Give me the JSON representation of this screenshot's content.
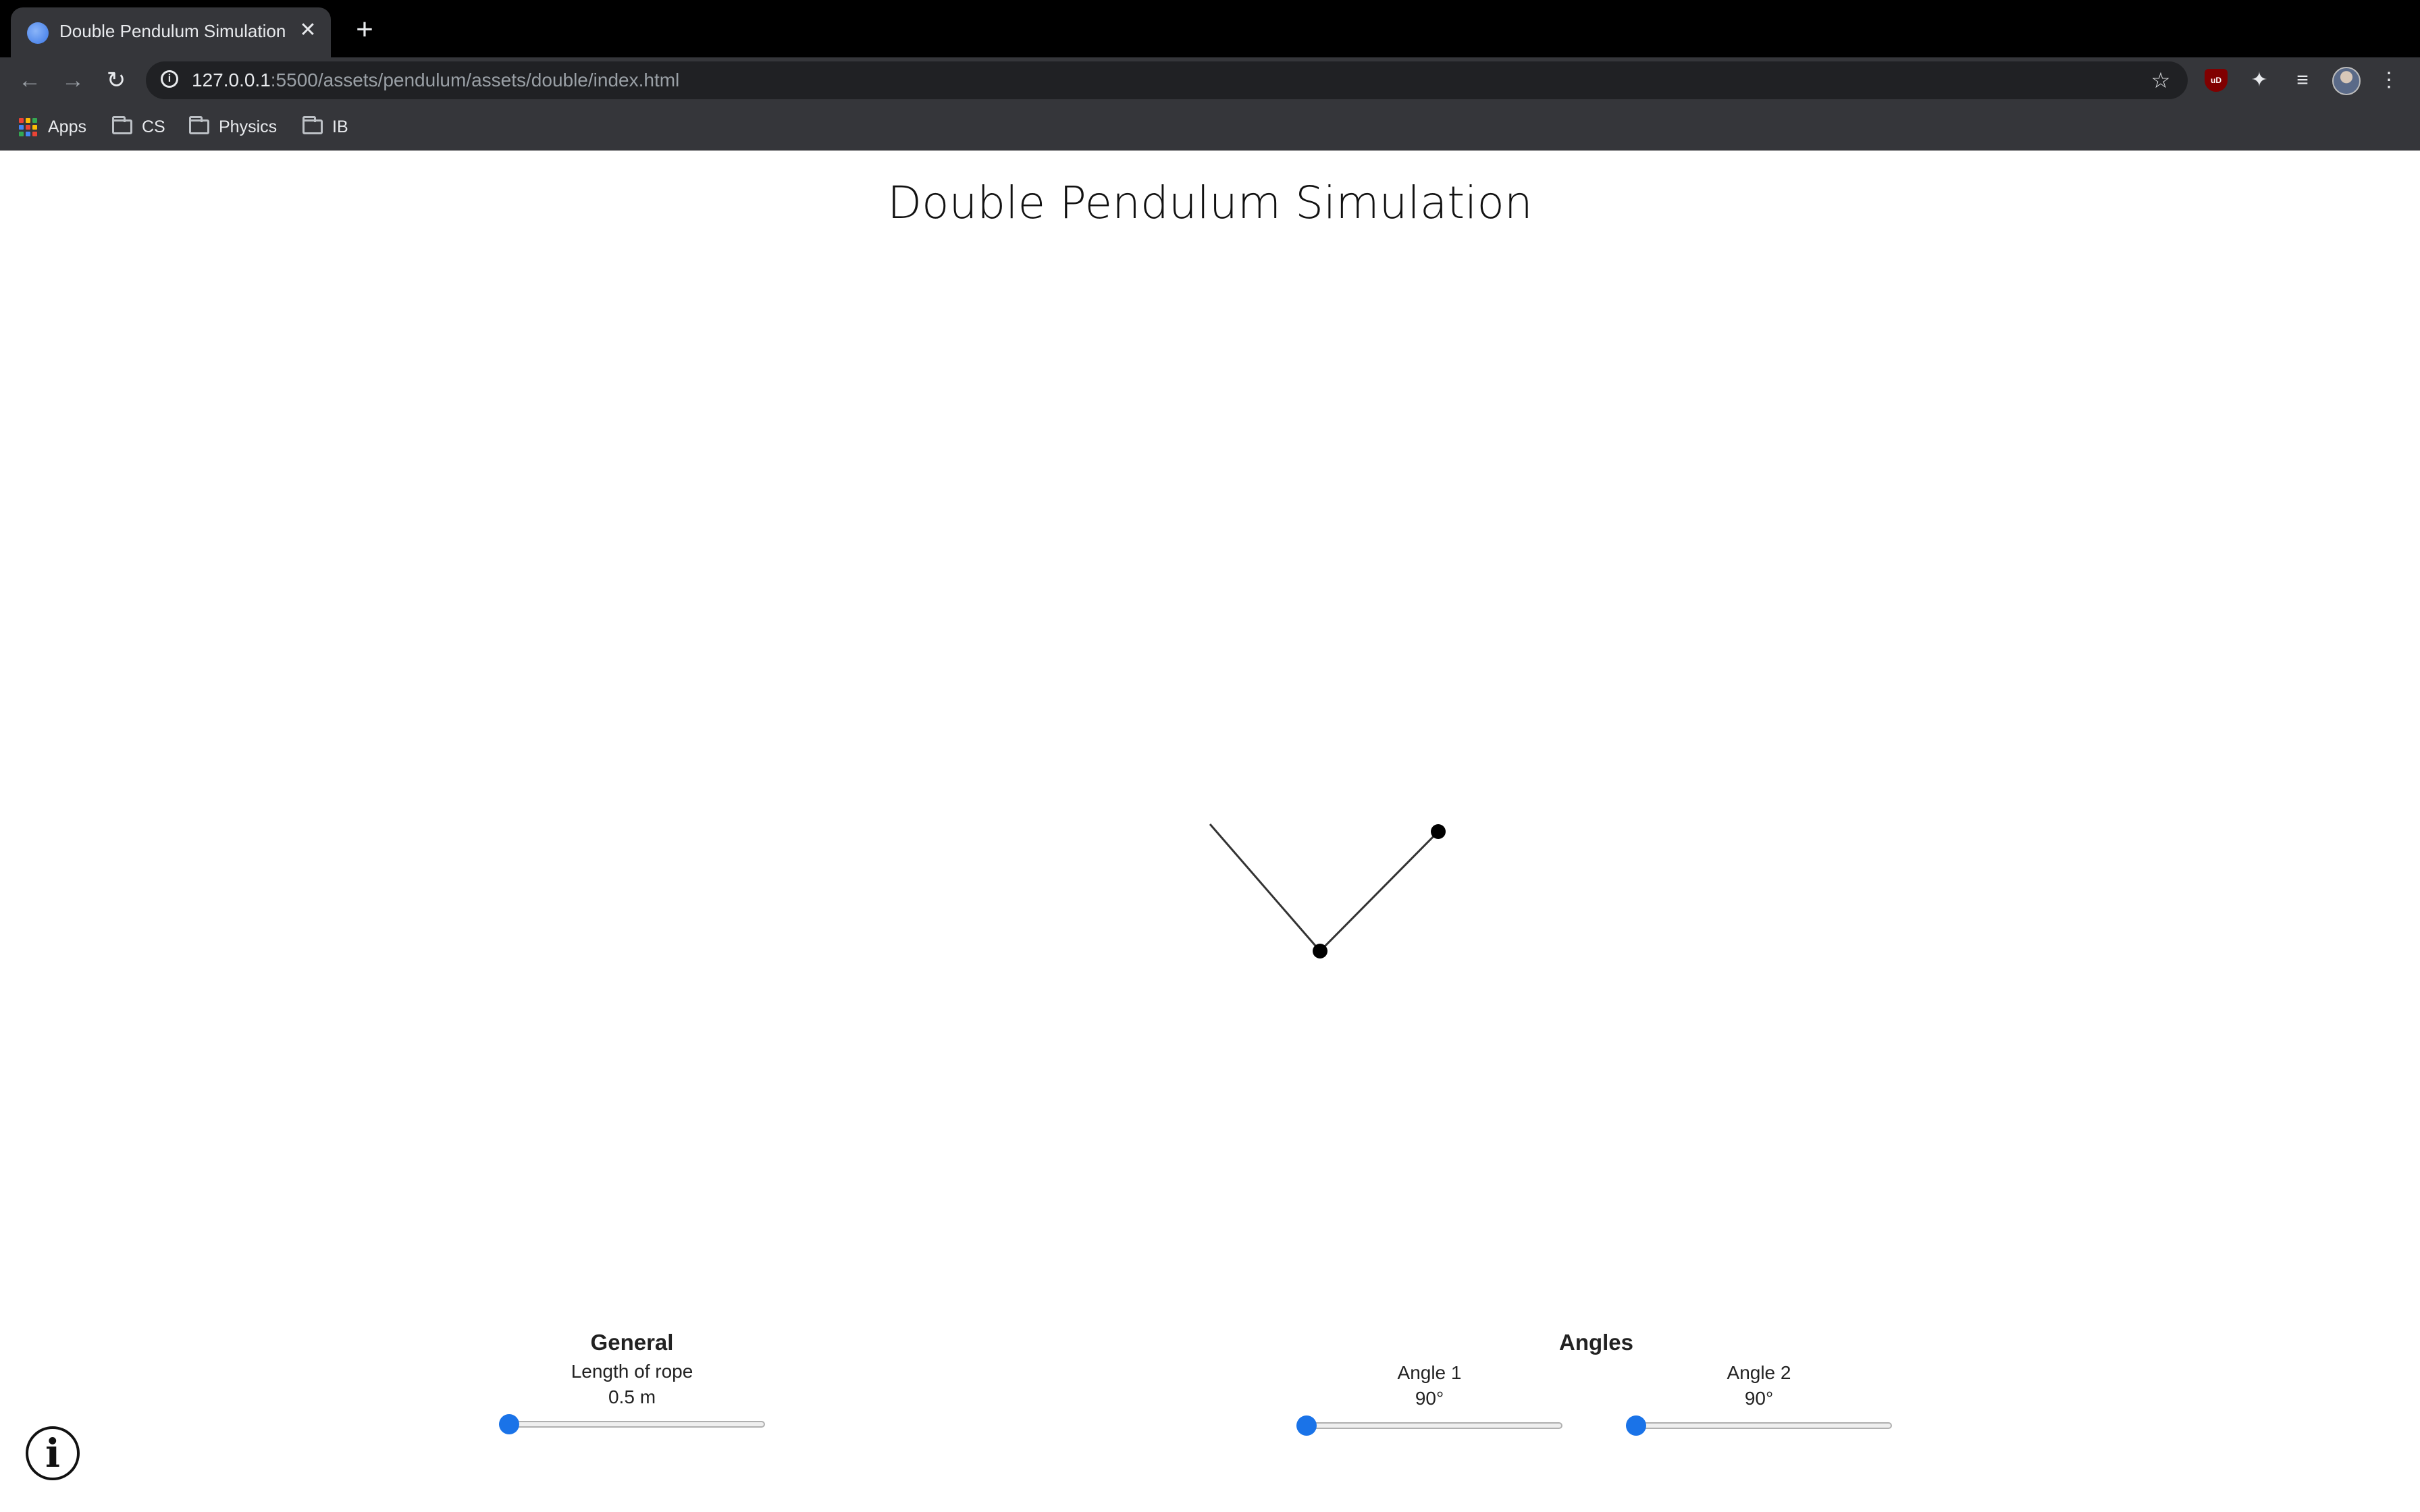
{
  "browser": {
    "tab_title": "Double Pendulum Simulation",
    "tab_close": "✕",
    "new_tab": "+",
    "url_host": "127.0.0.1",
    "url_path": ":5500/assets/pendulum/assets/double/index.html",
    "extension_label": "uD",
    "bookmarks": [
      {
        "label": "Apps",
        "icon": "apps-grid-icon"
      },
      {
        "label": "CS",
        "icon": "folder-icon"
      },
      {
        "label": "Physics",
        "icon": "folder-icon"
      },
      {
        "label": "IB",
        "icon": "folder-icon"
      }
    ]
  },
  "page": {
    "title": "Double Pendulum Simulation"
  },
  "controls": {
    "general": {
      "heading": "General",
      "rope_label": "Length of rope",
      "rope_value": "0.5 m",
      "rope_fraction": 0
    },
    "angles": {
      "heading": "Angles",
      "angle1_label": "Angle 1",
      "angle1_value": "90°",
      "angle1_fraction": 0,
      "angle2_label": "Angle 2",
      "angle2_value": "90°",
      "angle2_fraction": 0
    }
  },
  "help": {
    "icon_glyph": "i"
  },
  "colors": {
    "accent": "#1a73e8",
    "chrome_dark": "#35363a",
    "pendulum": "#000000"
  }
}
